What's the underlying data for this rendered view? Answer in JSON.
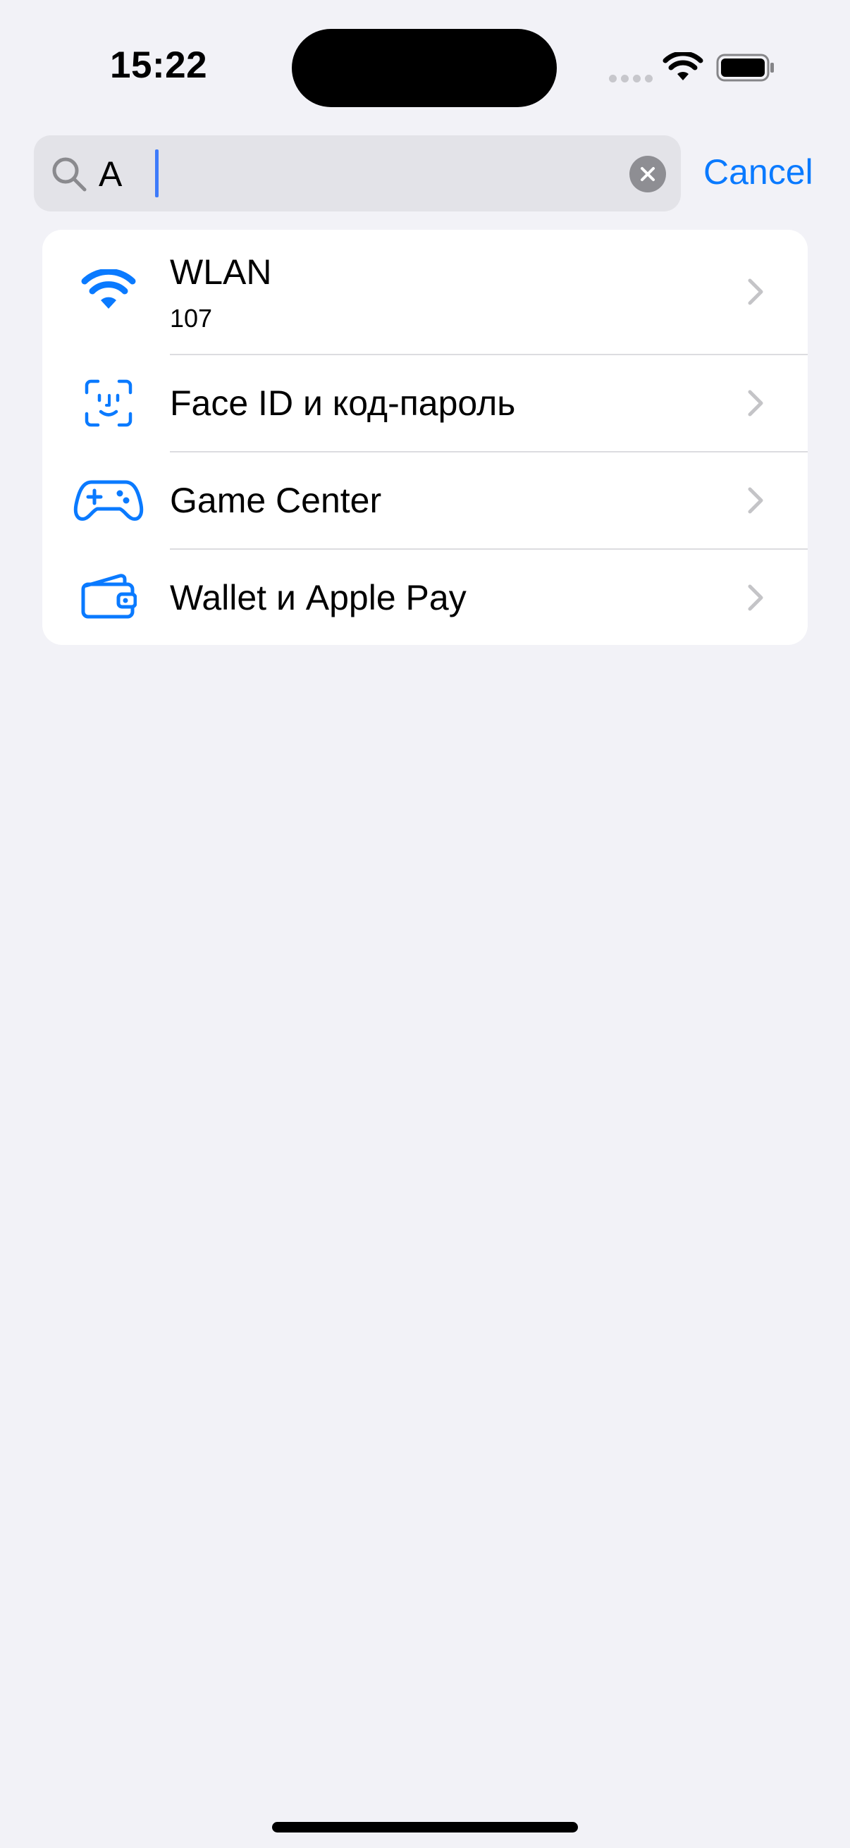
{
  "status_bar": {
    "time": "15:22"
  },
  "search": {
    "value": "A",
    "cancel_label": "Cancel"
  },
  "results": [
    {
      "title": "WLAN",
      "subtitle": "107",
      "icon": "wifi-icon"
    },
    {
      "title": "Face ID и код-пароль",
      "icon": "face-id-icon"
    },
    {
      "title": "Game Center",
      "icon": "game-controller-icon"
    },
    {
      "title": "Wallet и Apple Pay",
      "icon": "wallet-icon"
    }
  ],
  "colors": {
    "accent": "#0a7aff",
    "background": "#f2f2f7",
    "search_field": "#e3e3e8",
    "chevron": "#c4c4c7"
  }
}
